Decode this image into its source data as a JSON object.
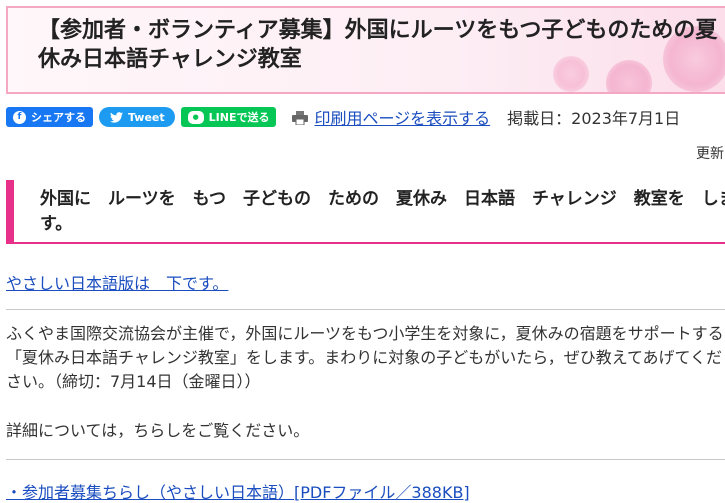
{
  "banner": {
    "title": "【参加者・ボランティア募集】外国にルーツをもつ子どものための夏休み日本語チャレンジ教室"
  },
  "share": {
    "facebook_label": "シェアする",
    "tweet_label": "Tweet",
    "line_label": "LINEで送る",
    "print_label": "印刷用ページを表示する",
    "post_date": "掲載日：2023年7月1日",
    "updated": "更新"
  },
  "heading": {
    "text": "外国に　ルーツを　もつ　子どもの　ための　夏休み　日本語　チャレンジ　教室を　します。"
  },
  "easy_link": "やさしい日本語版は　下です。",
  "body": {
    "paragraph1": "ふくやま国際交流協会が主催で，外国にルーツをもつ小学生を対象に，夏休みの宿題をサポートする「夏休み日本語チャレンジ教室」をします。まわりに対象の子どもがいたら，ぜひ教えてあげてください。（締切：7月14日（金曜日））",
    "paragraph2": "詳細については，ちらしをご覧ください。"
  },
  "pdf_link": "・参加者募集ちらし（やさしい日本語）[PDFファイル／388KB]",
  "colors": {
    "accent_pink": "#e6308a",
    "banner_border": "#f4a8c4",
    "link_blue": "#1a4dbf",
    "facebook_blue": "#1877f2",
    "twitter_blue": "#1d9bf0",
    "line_green": "#06c755"
  },
  "icons": {
    "facebook": "facebook-icon",
    "twitter": "twitter-bird-icon",
    "line": "line-icon",
    "print": "printer-icon"
  }
}
